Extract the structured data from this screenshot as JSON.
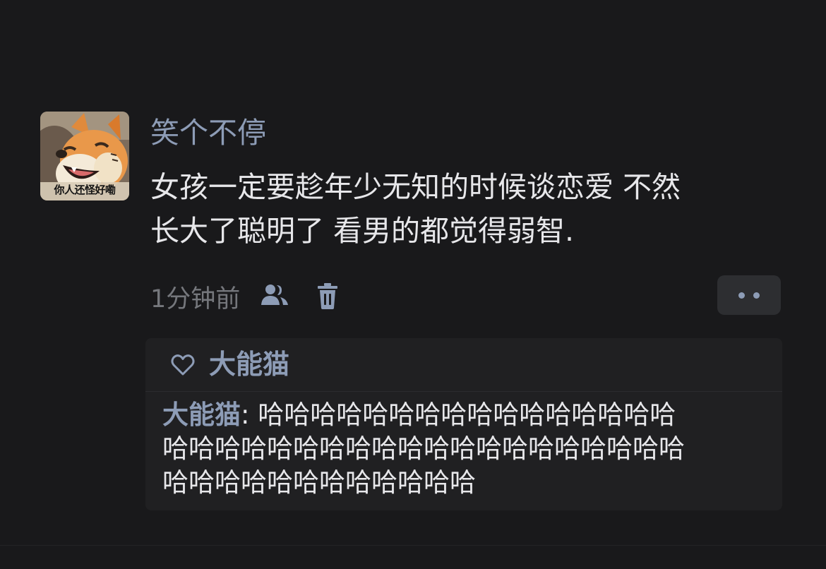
{
  "post": {
    "avatar": {
      "caption": "你人还怪好嘞"
    },
    "username": "笑个不停",
    "text_lines": [
      "女孩一定要趁年少无知的时候谈恋爱 不然",
      "长大了聪明了 看男的都觉得弱智."
    ],
    "timestamp": "1分钟前",
    "icons": {
      "people": "people-icon",
      "trash": "trash-icon",
      "more": "more-dots-icon",
      "heart": "heart-outline-icon"
    }
  },
  "reply_box": {
    "liker": "大能猫",
    "comment": {
      "author": "大能猫",
      "separator": ": ",
      "line1_text": "哈哈哈哈哈哈哈哈哈哈哈哈哈哈哈哈",
      "line2_text": "哈哈哈哈哈哈哈哈哈哈哈哈哈哈哈哈哈哈哈哈",
      "line3_text": "哈哈哈哈哈哈哈哈哈哈哈哈"
    }
  },
  "colors": {
    "background": "#19191b",
    "accent_name": "#8d9cb6",
    "text": "#e7e7ea",
    "muted": "#75777c",
    "reply_box_bg": "#202022",
    "button_bg": "#2d2e31"
  }
}
